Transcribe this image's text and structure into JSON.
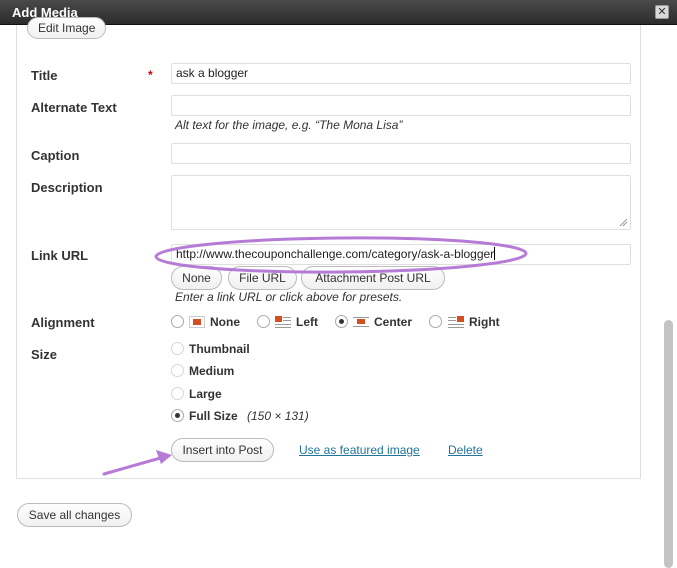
{
  "window": {
    "title": "Add Media",
    "close_glyph": "✕"
  },
  "edit_image_button": "Edit Image",
  "fields": {
    "title_label": "Title",
    "required_marker": "*",
    "title_value": "ask a blogger",
    "alt_label": "Alternate Text",
    "alt_value": "",
    "alt_help": "Alt text for the image, e.g. “The Mona Lisa”",
    "caption_label": "Caption",
    "caption_value": "",
    "description_label": "Description",
    "description_value": "",
    "link_label": "Link URL",
    "link_value": "http://www.thecouponchallenge.com/category/ask-a-blogger",
    "link_help": "Enter a link URL or click above for presets."
  },
  "link_buttons": {
    "none": "None",
    "file_url": "File URL",
    "attachment_post_url": "Attachment Post URL"
  },
  "alignment": {
    "label": "Alignment",
    "selected": "Center",
    "options": [
      {
        "label": "None",
        "icon": "align-none-icon"
      },
      {
        "label": "Left",
        "icon": "align-left-icon"
      },
      {
        "label": "Center",
        "icon": "align-center-icon"
      },
      {
        "label": "Right",
        "icon": "align-right-icon"
      }
    ]
  },
  "size": {
    "label": "Size",
    "selected": "Full Size",
    "options": [
      {
        "label": "Thumbnail",
        "enabled": false
      },
      {
        "label": "Medium",
        "enabled": false
      },
      {
        "label": "Large",
        "enabled": false
      },
      {
        "label": "Full Size",
        "enabled": true
      }
    ],
    "full_size_dimensions": "(150 × 131)"
  },
  "actions": {
    "insert_into_post": "Insert into Post",
    "use_as_featured": "Use as featured image",
    "delete": "Delete",
    "save_all": "Save all changes"
  },
  "colors": {
    "annotation": "#b57bd6",
    "link": "#21759b",
    "required": "#cc0000",
    "titlebar": "#333333"
  }
}
